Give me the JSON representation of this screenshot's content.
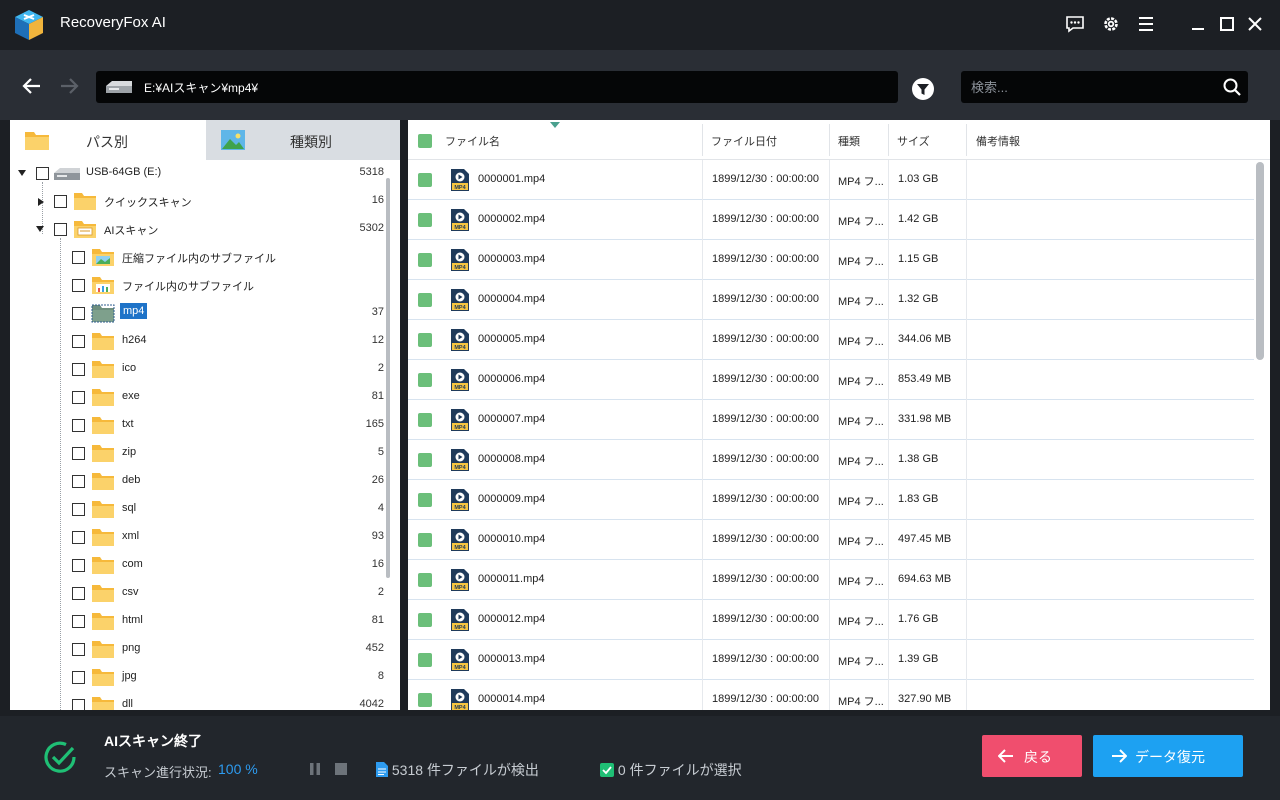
{
  "app": {
    "title": "RecoveryFox AI"
  },
  "toolbar": {
    "path": "E:¥AIスキャン¥mp4¥",
    "search_placeholder": "検索..."
  },
  "tabs": [
    {
      "label": "パス別"
    },
    {
      "label": "種類別"
    }
  ],
  "tree": [
    {
      "label": "USB-64GB (E:)",
      "count": "5318"
    },
    {
      "label": "クイックスキャン",
      "count": "16"
    },
    {
      "label": "AIスキャン",
      "count": "5302"
    },
    {
      "label": "圧縮ファイル内のサブファイル",
      "count": ""
    },
    {
      "label": "ファイル内のサブファイル",
      "count": ""
    },
    {
      "label": "mp4",
      "count": "37"
    },
    {
      "label": "h264",
      "count": "12"
    },
    {
      "label": "ico",
      "count": "2"
    },
    {
      "label": "exe",
      "count": "81"
    },
    {
      "label": "txt",
      "count": "165"
    },
    {
      "label": "zip",
      "count": "5"
    },
    {
      "label": "deb",
      "count": "26"
    },
    {
      "label": "sql",
      "count": "4"
    },
    {
      "label": "xml",
      "count": "93"
    },
    {
      "label": "com",
      "count": "16"
    },
    {
      "label": "csv",
      "count": "2"
    },
    {
      "label": "html",
      "count": "81"
    },
    {
      "label": "png",
      "count": "452"
    },
    {
      "label": "jpg",
      "count": "8"
    },
    {
      "label": "dll",
      "count": "4042"
    }
  ],
  "table": {
    "columns": [
      "ファイル名",
      "ファイル日付",
      "種類",
      "サイズ",
      "備考情報"
    ],
    "rows": [
      {
        "name": "0000001.mp4",
        "date": "1899/12/30 : 00:00:00",
        "type": "MP4 フ...",
        "size": "1.03 GB"
      },
      {
        "name": "0000002.mp4",
        "date": "1899/12/30 : 00:00:00",
        "type": "MP4 フ...",
        "size": "1.42 GB"
      },
      {
        "name": "0000003.mp4",
        "date": "1899/12/30 : 00:00:00",
        "type": "MP4 フ...",
        "size": "1.15 GB"
      },
      {
        "name": "0000004.mp4",
        "date": "1899/12/30 : 00:00:00",
        "type": "MP4 フ...",
        "size": "1.32 GB"
      },
      {
        "name": "0000005.mp4",
        "date": "1899/12/30 : 00:00:00",
        "type": "MP4 フ...",
        "size": "344.06 MB"
      },
      {
        "name": "0000006.mp4",
        "date": "1899/12/30 : 00:00:00",
        "type": "MP4 フ...",
        "size": "853.49 MB"
      },
      {
        "name": "0000007.mp4",
        "date": "1899/12/30 : 00:00:00",
        "type": "MP4 フ...",
        "size": "331.98 MB"
      },
      {
        "name": "0000008.mp4",
        "date": "1899/12/30 : 00:00:00",
        "type": "MP4 フ...",
        "size": "1.38 GB"
      },
      {
        "name": "0000009.mp4",
        "date": "1899/12/30 : 00:00:00",
        "type": "MP4 フ...",
        "size": "1.83 GB"
      },
      {
        "name": "0000010.mp4",
        "date": "1899/12/30 : 00:00:00",
        "type": "MP4 フ...",
        "size": "497.45 MB"
      },
      {
        "name": "0000011.mp4",
        "date": "1899/12/30 : 00:00:00",
        "type": "MP4 フ...",
        "size": "694.63 MB"
      },
      {
        "name": "0000012.mp4",
        "date": "1899/12/30 : 00:00:00",
        "type": "MP4 フ...",
        "size": "1.76 GB"
      },
      {
        "name": "0000013.mp4",
        "date": "1899/12/30 : 00:00:00",
        "type": "MP4 フ...",
        "size": "1.39 GB"
      },
      {
        "name": "0000014.mp4",
        "date": "1899/12/30 : 00:00:00",
        "type": "MP4 フ...",
        "size": "327.90 MB"
      }
    ]
  },
  "status": {
    "title": "AIスキャン終了",
    "progress_label": "スキャン進行状況:",
    "progress_value": "100 %",
    "found_count": "5318",
    "found_label": "件ファイルが検出",
    "selected_count": "0",
    "selected_label": "件ファイルが選択"
  },
  "buttons": {
    "back": "戻る",
    "recover": "データ復元"
  },
  "colors": {
    "accent": "#1da1f2",
    "back": "#f04e6e",
    "check": "#6bbf7a",
    "success": "#1fbf75"
  },
  "icons": {
    "logo": "cube-logo-icon",
    "feedback": "chat-icon",
    "settings": "gear-icon",
    "menu": "hamburger-icon",
    "file": "mp4-file-icon"
  }
}
